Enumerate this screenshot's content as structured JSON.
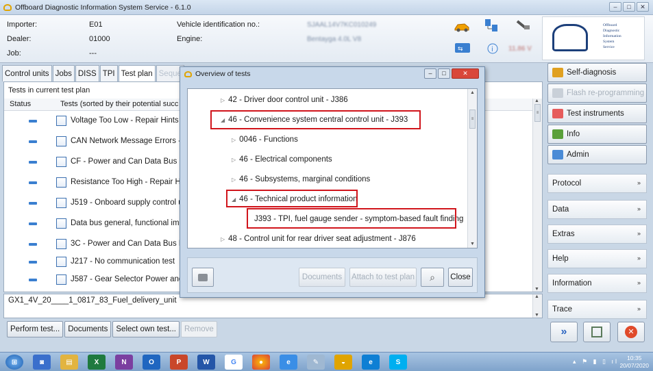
{
  "window": {
    "title": "Offboard Diagnostic Information System Service - 6.1.0"
  },
  "header": {
    "importer_label": "Importer:",
    "importer_value": "E01",
    "dealer_label": "Dealer:",
    "dealer_value": "01000",
    "job_label": "Job:",
    "job_value": "---",
    "vin_label": "Vehicle identification no.:",
    "vin_value": "SJAAL14V7KC010249",
    "engine_label": "Engine:",
    "engine_value": "Bentayga 4.0L V8",
    "voltage": "11.86 V",
    "logo_lines": [
      "Offboard",
      "Diagnostic",
      "Information",
      "System",
      "Service"
    ]
  },
  "tabs": [
    {
      "label": "Control units"
    },
    {
      "label": "Jobs"
    },
    {
      "label": "DISS"
    },
    {
      "label": "TPI"
    },
    {
      "label": "Test plan"
    },
    {
      "label": "Seque"
    }
  ],
  "testplan": {
    "title": "Tests in current test plan",
    "col_status": "Status",
    "col_tests": "Tests (sorted by their potential succ",
    "rows": [
      {
        "label": "Voltage Too Low - Repair Hints"
      },
      {
        "label": "CAN Network Message Errors -"
      },
      {
        "label": "CF - Power and Can Data Bus F"
      },
      {
        "label": "Resistance Too High - Repair H"
      },
      {
        "label": "J519 - Onboard supply control u"
      },
      {
        "label": "Data bus general, functional imp"
      },
      {
        "label": "3C - Power and Can Data Bus F"
      },
      {
        "label": "J217 - No communication test"
      },
      {
        "label": "J587 - Gear Selector Power and"
      }
    ],
    "path": "GX1_4V_20____1_0817_83_Fuel_delivery_unit"
  },
  "bottom_buttons": {
    "perform": "Perform test...",
    "documents": "Documents",
    "select_own": "Select own test...",
    "remove": "Remove"
  },
  "right": {
    "self_diagnosis": "Self-diagnosis",
    "flash": "Flash re-programming",
    "test_instruments": "Test instruments",
    "info": "Info",
    "admin": "Admin",
    "sections": [
      "Protocol",
      "Data",
      "Extras",
      "Help",
      "Information",
      "Trace"
    ]
  },
  "modal": {
    "title": "Overview of tests",
    "tree": [
      {
        "label": "42 - Driver door control unit - J386",
        "expanded": false
      },
      {
        "label": "46 - Convenience system central control unit - J393",
        "expanded": true
      },
      {
        "label": "0046 - Functions",
        "expanded": false
      },
      {
        "label": "46 - Electrical components",
        "expanded": false
      },
      {
        "label": "46 - Subsystems, marginal conditions",
        "expanded": false
      },
      {
        "label": "46 - Technical product information",
        "expanded": true
      },
      {
        "label": "J393 - TPI, fuel gauge sender - symptom-based fault finding",
        "leaf": true
      },
      {
        "label": "48 - Control unit for rear driver seat adjustment - J876",
        "expanded": false
      }
    ],
    "buttons": {
      "documents": "Documents",
      "attach": "Attach to test plan",
      "close": "Close"
    }
  },
  "taskbar": {
    "time": "10:35",
    "date": "20/07/2020"
  },
  "colors": {
    "highlight": "#d0141b",
    "accent": "#3a7fd0"
  }
}
